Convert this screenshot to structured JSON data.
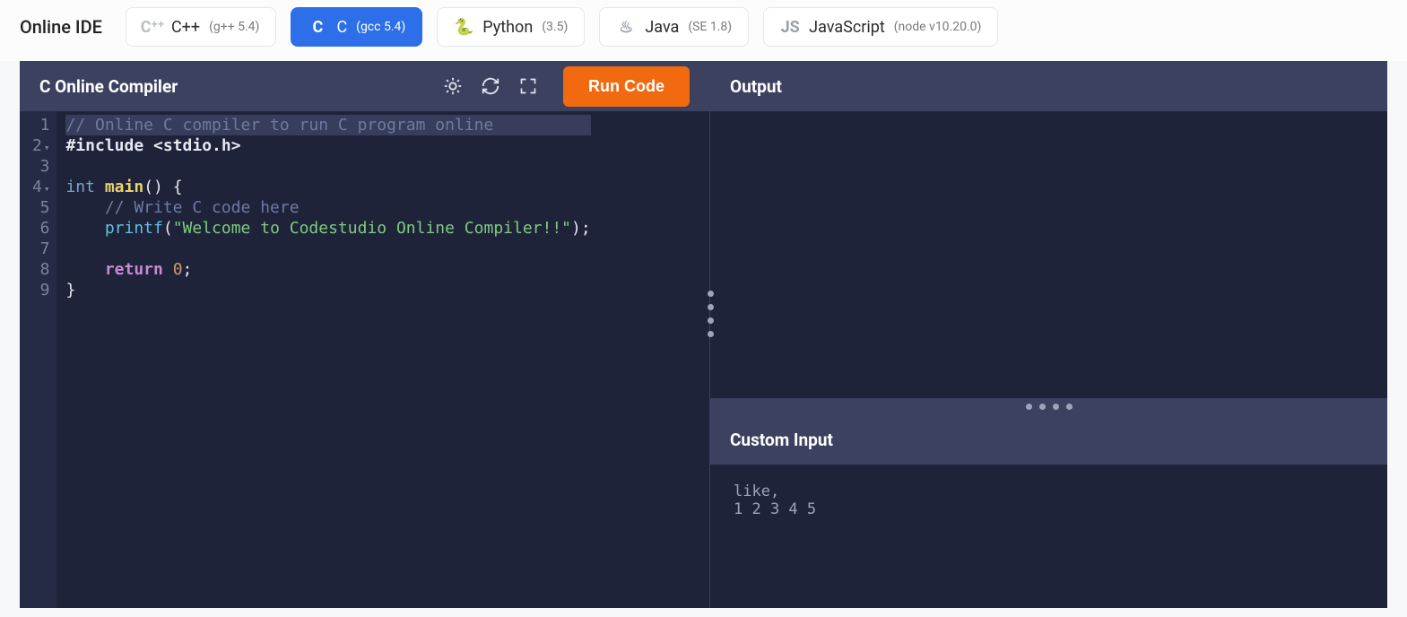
{
  "header": {
    "brand": "Online IDE",
    "languages": [
      {
        "icon": "C⁺⁺",
        "name": "C++",
        "version": "(g++ 5.4)",
        "active": false,
        "iconColor": "#b9bcc4"
      },
      {
        "icon": "C",
        "name": "C",
        "version": "(gcc 5.4)",
        "active": true,
        "iconColor": "#ffffff"
      },
      {
        "icon": "🐍",
        "name": "Python",
        "version": "(3.5)",
        "active": false,
        "iconColor": "#9aa0ab"
      },
      {
        "icon": "♨",
        "name": "Java",
        "version": "(SE 1.8)",
        "active": false,
        "iconColor": "#9aa0ab"
      },
      {
        "icon": "JS",
        "name": "JavaScript",
        "version": "(node v10.20.0)",
        "active": false,
        "iconColor": "#9aa0ab"
      }
    ]
  },
  "editor": {
    "title": "C Online Compiler",
    "run_label": "Run Code",
    "lines": [
      {
        "n": "1",
        "fold": false,
        "highlight": true,
        "html": "<span class='tok-comment'>// Online C compiler to run C program online</span>"
      },
      {
        "n": "2",
        "fold": true,
        "highlight": false,
        "html": "<span class='tok-preproc'>#include</span> <span class='tok-include'>&lt;stdio.h&gt;</span>"
      },
      {
        "n": "3",
        "fold": false,
        "highlight": false,
        "html": ""
      },
      {
        "n": "4",
        "fold": true,
        "highlight": false,
        "html": "<span class='tok-type'>int</span> <span class='tok-func'>main</span><span class='tok-paren'>()</span> <span class='tok-brace'>{</span>"
      },
      {
        "n": "5",
        "fold": false,
        "highlight": false,
        "html": "    <span class='tok-comment'>// Write C code here</span>"
      },
      {
        "n": "6",
        "fold": false,
        "highlight": false,
        "html": "    <span class='tok-call'>printf</span><span class='tok-paren'>(</span><span class='tok-string'>\"Welcome to Codestudio Online Compiler!!\"</span><span class='tok-paren'>)</span>;"
      },
      {
        "n": "7",
        "fold": false,
        "highlight": false,
        "html": ""
      },
      {
        "n": "8",
        "fold": false,
        "highlight": false,
        "html": "    <span class='tok-kw'>return</span> <span class='tok-num'>0</span>;"
      },
      {
        "n": "9",
        "fold": false,
        "highlight": false,
        "html": "<span class='tok-brace'>}</span>"
      }
    ]
  },
  "output": {
    "title": "Output",
    "content": ""
  },
  "custom_input": {
    "title": "Custom Input",
    "content": "like,\n1 2 3 4 5"
  }
}
